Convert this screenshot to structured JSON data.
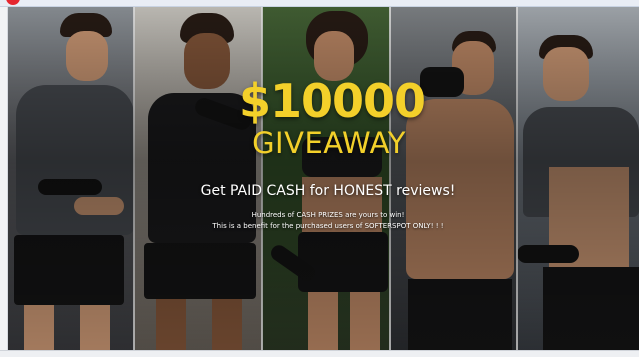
{
  "banner": {
    "amount": "$10000",
    "title": "GIVEAWAY",
    "headline": "Get PAID CASH for HONEST reviews!",
    "subline_1": "Hundreds of CASH PRIZES are yours to win!",
    "subline_2": "This is a benefit for the purchased users of SOFTERSPOT ONLY! ! !"
  },
  "colors": {
    "accent_gold": "#f3d02a",
    "notification": "#e6262f"
  },
  "icons": {
    "notification": "notification-dot-icon"
  }
}
